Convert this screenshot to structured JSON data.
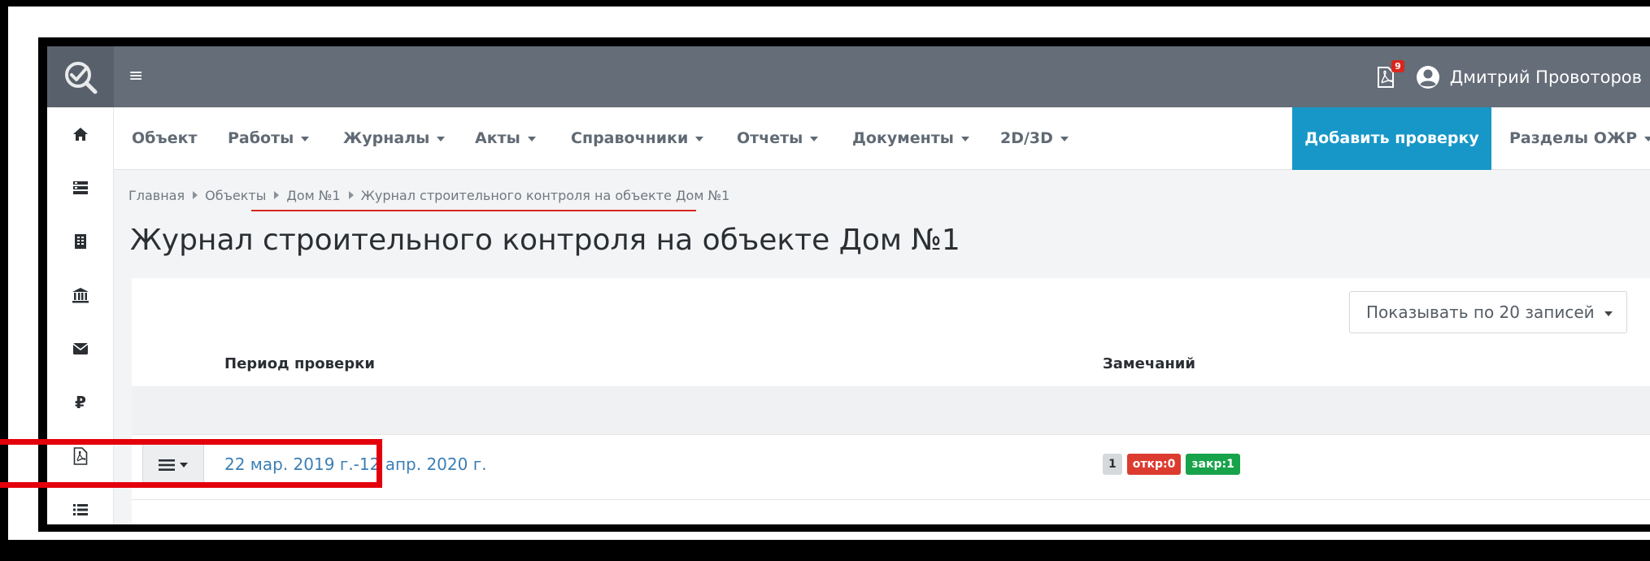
{
  "topbar": {
    "notification_count": "9",
    "user_name": "Дмитрий Провоторов"
  },
  "navbar": {
    "items": [
      {
        "label": "Объект",
        "dropdown": false
      },
      {
        "label": "Работы",
        "dropdown": true
      },
      {
        "label": "Журналы",
        "dropdown": true
      },
      {
        "label": "Акты",
        "dropdown": true
      },
      {
        "label": "Справочники",
        "dropdown": true
      },
      {
        "label": "Отчеты",
        "dropdown": true
      },
      {
        "label": "Документы",
        "dropdown": true
      },
      {
        "label": "2D/3D",
        "dropdown": true
      }
    ],
    "add_button": "Добавить проверку",
    "sections_menu": "Разделы ОЖР"
  },
  "sidebar": {
    "icons": [
      "home-icon",
      "server-icon",
      "building-icon",
      "bank-icon",
      "envelope-icon",
      "ruble-icon",
      "pdf-file-icon",
      "list-icon"
    ]
  },
  "breadcrumb": {
    "items": [
      "Главная",
      "Объекты",
      "Дом №1",
      "Журнал строительного контроля на объекте Дом №1"
    ]
  },
  "page": {
    "title": "Журнал строительного контроля на объекте Дом №1"
  },
  "table": {
    "page_size_select": "Показывать по 20 записей",
    "headers": {
      "period": "Период проверки",
      "remarks": "Замечаний"
    },
    "rows": [
      {
        "period": "22 мар. 2019 г.-12 апр. 2020 г.",
        "remarks_total": "1",
        "remarks_open": "откр:0",
        "remarks_closed": "закр:1"
      }
    ]
  },
  "colors": {
    "topbar": "#646d78",
    "primary_button": "#1797c8",
    "link": "#3b7fb5",
    "badge_open": "#dc3c2f",
    "badge_closed": "#17a34a",
    "annotation": "#e3000b"
  }
}
